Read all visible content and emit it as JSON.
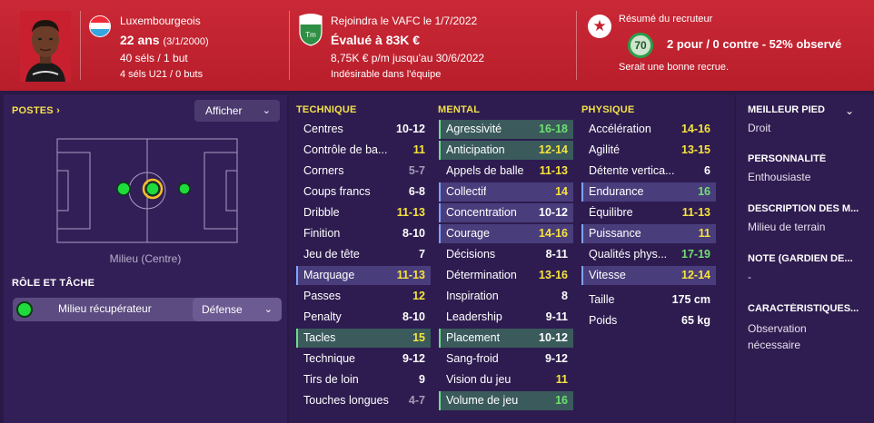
{
  "header": {
    "nationality": "Luxembourgeois",
    "age": "22 ans",
    "birthdate": "(3/1/2000)",
    "caps": "40 séls / 1 but",
    "u21_caps": "4 séls U21 / 0 buts",
    "transfer_line": "Rejoindra le VAFC le 1/7/2022",
    "value": "Évalué à 83K €",
    "wage": "8,75K € p/m jusqu'au 30/6/2022",
    "status": "Indésirable dans l'équipe",
    "scout_title": "Résumé du recruteur",
    "scout_rating": "70",
    "scout_votes": "2 pour / 0 contre - 52% observé",
    "scout_verdict": "Serait une bonne recrue.",
    "club_badge_text": "Tm",
    "colors": {
      "header_bg": "#c8202e",
      "flag_red": "#ee2a36",
      "flag_white": "#ffffff",
      "flag_blue": "#35a6e0"
    }
  },
  "left": {
    "positions_title": "POSTES",
    "positions_arrow": "›",
    "show_dropdown": "Afficher",
    "position_label": "Milieu (Centre)",
    "role_title": "RÔLE ET TÂCHE",
    "role_name": "Milieu récupérateur",
    "duty": "Défense"
  },
  "attributes": {
    "technical": {
      "title": "TECHNIQUE",
      "rows": [
        {
          "name": "Centres",
          "value": "10-12",
          "tier": "mid",
          "hl": false
        },
        {
          "name": "Contrôle de ba...",
          "value": "11",
          "tier": "good",
          "hl": false
        },
        {
          "name": "Corners",
          "value": "5-7",
          "tier": "low",
          "hl": false
        },
        {
          "name": "Coups francs",
          "value": "6-8",
          "tier": "mid",
          "hl": false
        },
        {
          "name": "Dribble",
          "value": "11-13",
          "tier": "good",
          "hl": false
        },
        {
          "name": "Finition",
          "value": "8-10",
          "tier": "mid",
          "hl": false
        },
        {
          "name": "Jeu de tête",
          "value": "7",
          "tier": "mid",
          "hl": false
        },
        {
          "name": "Marquage",
          "value": "11-13",
          "tier": "good",
          "hl": "blue"
        },
        {
          "name": "Passes",
          "value": "12",
          "tier": "good",
          "hl": false
        },
        {
          "name": "Penalty",
          "value": "8-10",
          "tier": "mid",
          "hl": false
        },
        {
          "name": "Tacles",
          "value": "15",
          "tier": "good",
          "hl": "green"
        },
        {
          "name": "Technique",
          "value": "9-12",
          "tier": "mid",
          "hl": false
        },
        {
          "name": "Tirs de loin",
          "value": "9",
          "tier": "mid",
          "hl": false
        },
        {
          "name": "Touches longues",
          "value": "4-7",
          "tier": "low",
          "hl": false
        }
      ]
    },
    "mental": {
      "title": "MENTAL",
      "rows": [
        {
          "name": "Agressivité",
          "value": "16-18",
          "tier": "great",
          "hl": "green"
        },
        {
          "name": "Anticipation",
          "value": "12-14",
          "tier": "good",
          "hl": "green"
        },
        {
          "name": "Appels de balle",
          "value": "11-13",
          "tier": "good",
          "hl": false
        },
        {
          "name": "Collectif",
          "value": "14",
          "tier": "good",
          "hl": "blue"
        },
        {
          "name": "Concentration",
          "value": "10-12",
          "tier": "mid",
          "hl": "blue"
        },
        {
          "name": "Courage",
          "value": "14-16",
          "tier": "good",
          "hl": "blue"
        },
        {
          "name": "Décisions",
          "value": "8-11",
          "tier": "mid",
          "hl": false
        },
        {
          "name": "Détermination",
          "value": "13-16",
          "tier": "good",
          "hl": false
        },
        {
          "name": "Inspiration",
          "value": "8",
          "tier": "mid",
          "hl": false
        },
        {
          "name": "Leadership",
          "value": "9-11",
          "tier": "mid",
          "hl": false
        },
        {
          "name": "Placement",
          "value": "10-12",
          "tier": "mid",
          "hl": "green"
        },
        {
          "name": "Sang-froid",
          "value": "9-12",
          "tier": "mid",
          "hl": false
        },
        {
          "name": "Vision du jeu",
          "value": "11",
          "tier": "good",
          "hl": false
        },
        {
          "name": "Volume de jeu",
          "value": "16",
          "tier": "great",
          "hl": "green"
        }
      ]
    },
    "physical": {
      "title": "PHYSIQUE",
      "rows": [
        {
          "name": "Accélération",
          "value": "14-16",
          "tier": "good",
          "hl": false
        },
        {
          "name": "Agilité",
          "value": "13-15",
          "tier": "good",
          "hl": false
        },
        {
          "name": "Détente vertica...",
          "value": "6",
          "tier": "mid",
          "hl": false
        },
        {
          "name": "Endurance",
          "value": "16",
          "tier": "great",
          "hl": "blue"
        },
        {
          "name": "Équilibre",
          "value": "11-13",
          "tier": "good",
          "hl": false
        },
        {
          "name": "Puissance",
          "value": "11",
          "tier": "good",
          "hl": "blue"
        },
        {
          "name": "Qualités phys...",
          "value": "17-19",
          "tier": "great",
          "hl": false
        },
        {
          "name": "Vitesse",
          "value": "12-14",
          "tier": "good",
          "hl": "blue"
        }
      ],
      "height_label": "Taille",
      "height_value": "175 cm",
      "weight_label": "Poids",
      "weight_value": "65 kg"
    }
  },
  "right": {
    "foot_label": "MEILLEUR PIED",
    "foot_value": "Droit",
    "personality_label": "PERSONNALITÉ",
    "personality_value": "Enthousiaste",
    "description_label": "DESCRIPTION DES M...",
    "description_value": "Milieu de terrain",
    "gk_note_label": "NOTE (GARDIEN DE...",
    "gk_note_value": "-",
    "traits_label": "CARACTÉRISTIQUES...",
    "traits_value_1": "Observation",
    "traits_value_2": "nécessaire"
  }
}
